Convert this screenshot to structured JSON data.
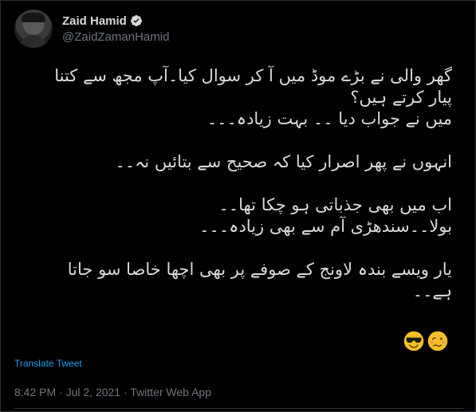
{
  "author": {
    "name": "Zaid Hamid",
    "handle": "@ZaidZamanHamid",
    "verified_icon": "verified-badge-icon",
    "avatar_icon": "avatar"
  },
  "tweet": {
    "paragraphs": [
      {
        "lines": [
          "گھر والی نے بڑے موڈ میں آ کر سوال کیا۔آپ مجھ سے کتنا",
          "پیار کرتے ہیں؟",
          "میں نے جواب دیا ۔۔ بہت زیادہ۔۔۔"
        ]
      },
      {
        "lines": [
          "انہوں نے پھر اصرار کیا کہ صحیح سے بتائیں نہ۔۔"
        ]
      },
      {
        "lines": [
          "اب میں بھی جذباتی ہو چکا تھا۔۔",
          "بولا۔۔سندھڑی آم سے بھی زیادہ۔۔۔"
        ]
      },
      {
        "lines": [
          "یار ویسے بندہ لاونج کے صوفے پر بھی اچھا خاصا سو جاتا",
          "ہے۔۔"
        ]
      }
    ],
    "emojis": [
      "sunglasses-emoji",
      "woozy-face-emoji"
    ]
  },
  "translate_label": "Translate Tweet",
  "meta": {
    "time": "8:42 PM",
    "separator": " · ",
    "date": "Jul 2, 2021",
    "source": "Twitter Web App"
  },
  "colors": {
    "background": "#000000",
    "text": "#d9d9d9",
    "muted": "#6e767d",
    "link": "#1d9bf0",
    "verified": "#d9d9d9",
    "emoji": "#f4c025"
  }
}
